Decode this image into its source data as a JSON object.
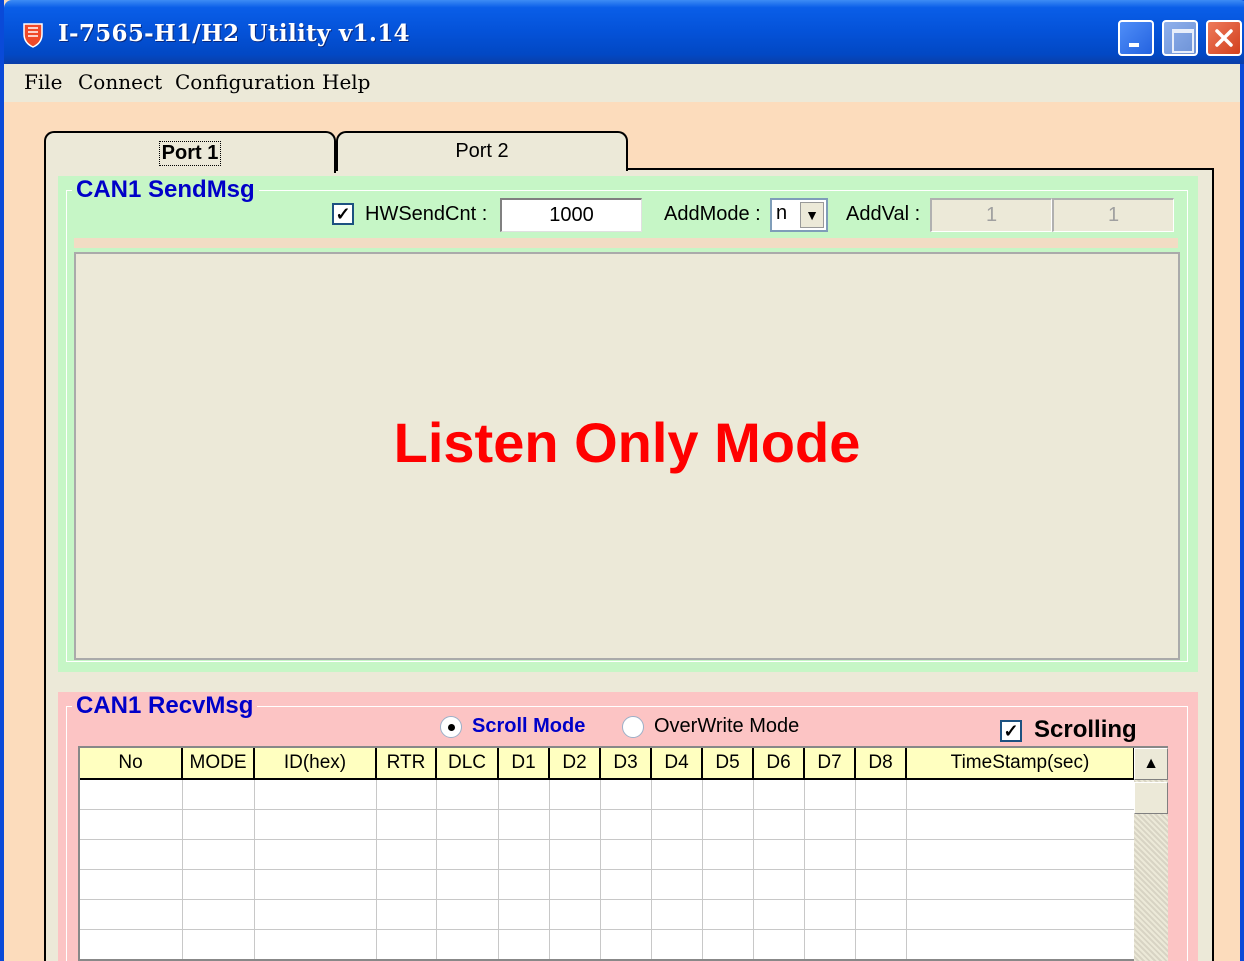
{
  "window": {
    "title": "I-7565-H1/H2 Utility v1.14",
    "app_icon": "shield-icon",
    "controls": [
      "minimize-icon",
      "maximize-icon",
      "close-icon"
    ]
  },
  "menu": {
    "items": [
      "File",
      "Connect",
      "Configuration",
      "Help"
    ]
  },
  "tabs": [
    {
      "label": "Port 1",
      "selected": true
    },
    {
      "label": "Port 2",
      "selected": false
    }
  ],
  "send": {
    "title": "CAN1 SendMsg",
    "hw_send_cnt_label": "HWSendCnt :",
    "hw_send_cnt_checked": true,
    "hw_send_cnt_value": "1000",
    "add_mode_label": "AddMode :",
    "add_mode_value": "n",
    "add_val_label": "AddVal :",
    "add_val_1": "1",
    "add_val_2": "1",
    "mode_message": "Listen Only Mode",
    "mode_message_color": "#ff0000",
    "section_color": "#c6f6c6"
  },
  "recv": {
    "title": "CAN1 RecvMsg",
    "scroll_mode_label": "Scroll Mode",
    "overwrite_mode_label": "OverWrite Mode",
    "selected_mode": "Scroll Mode",
    "scrolling_label": "Scrolling",
    "scrolling_checked": true,
    "section_color": "#fcc4c4",
    "columns": [
      "No",
      "MODE",
      "ID(hex)",
      "RTR",
      "DLC",
      "D1",
      "D2",
      "D3",
      "D4",
      "D5",
      "D6",
      "D7",
      "D8",
      "TimeStamp(sec)"
    ],
    "rows": [
      [
        "",
        "",
        "",
        "",
        "",
        "",
        "",
        "",
        "",
        "",
        "",
        "",
        "",
        ""
      ],
      [
        "",
        "",
        "",
        "",
        "",
        "",
        "",
        "",
        "",
        "",
        "",
        "",
        "",
        ""
      ],
      [
        "",
        "",
        "",
        "",
        "",
        "",
        "",
        "",
        "",
        "",
        "",
        "",
        "",
        ""
      ],
      [
        "",
        "",
        "",
        "",
        "",
        "",
        "",
        "",
        "",
        "",
        "",
        "",
        "",
        ""
      ],
      [
        "",
        "",
        "",
        "",
        "",
        "",
        "",
        "",
        "",
        "",
        "",
        "",
        "",
        ""
      ],
      [
        "",
        "",
        "",
        "",
        "",
        "",
        "",
        "",
        "",
        "",
        "",
        "",
        "",
        ""
      ]
    ]
  },
  "colors": {
    "title_bar": "#0452d8",
    "client_bg": "#fcdcbc",
    "group_title": "#0000c8",
    "header_bg": "#ffffc0"
  }
}
